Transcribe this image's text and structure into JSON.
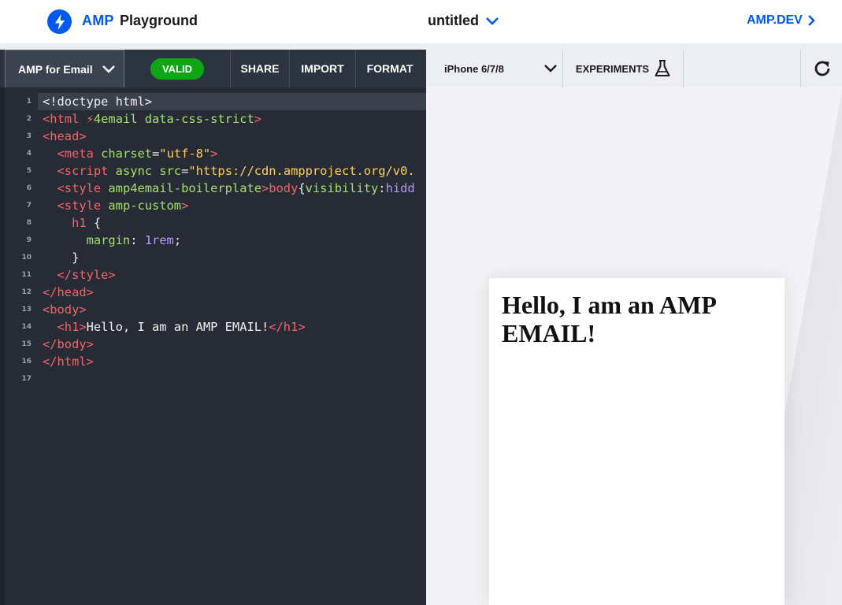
{
  "header": {
    "brand_amp": "AMP",
    "brand_playground": "Playground",
    "document_title": "untitled",
    "ampdev_link": "AMP.DEV"
  },
  "editor_toolbar": {
    "format_select": "AMP for Email",
    "valid_badge": "VALID",
    "share": "SHARE",
    "import": "IMPORT",
    "format": "FORMAT"
  },
  "preview_toolbar": {
    "device_select": "iPhone 6/7/8",
    "experiments": "EXPERIMENTS"
  },
  "editor": {
    "line_numbers": [
      "1",
      "2",
      "3",
      "4",
      "5",
      "6",
      "7",
      "8",
      "9",
      "10",
      "11",
      "12",
      "13",
      "14",
      "15",
      "16",
      "17"
    ],
    "lines": [
      [
        {
          "t": "txt",
          "v": "<!doctype html>"
        }
      ],
      [
        {
          "t": "tag",
          "v": "<html "
        },
        {
          "t": "bolt",
          "v": "⚡"
        },
        {
          "t": "attr",
          "v": "4email data-css-strict"
        },
        {
          "t": "tag",
          "v": ">"
        }
      ],
      [
        {
          "t": "tag",
          "v": "<head>"
        }
      ],
      [
        {
          "t": "tag",
          "v": "  <meta "
        },
        {
          "t": "attr",
          "v": "charset"
        },
        {
          "t": "txt",
          "v": "="
        },
        {
          "t": "str",
          "v": "\"utf-8\""
        },
        {
          "t": "tag",
          "v": ">"
        }
      ],
      [
        {
          "t": "tag",
          "v": "  <script "
        },
        {
          "t": "attr",
          "v": "async src"
        },
        {
          "t": "txt",
          "v": "="
        },
        {
          "t": "str",
          "v": "\"https://cdn.ampproject.org/v0."
        }
      ],
      [
        {
          "t": "tag",
          "v": "  <style "
        },
        {
          "t": "attr",
          "v": "amp4email-boilerplate"
        },
        {
          "t": "tag",
          "v": ">body"
        },
        {
          "t": "txt",
          "v": "{"
        },
        {
          "t": "attr",
          "v": "visibility"
        },
        {
          "t": "txt",
          "v": ":"
        },
        {
          "t": "num",
          "v": "hidd"
        }
      ],
      [
        {
          "t": "tag",
          "v": "  <style "
        },
        {
          "t": "attr",
          "v": "amp-custom"
        },
        {
          "t": "tag",
          "v": ">"
        }
      ],
      [
        {
          "t": "tag",
          "v": "    h1 "
        },
        {
          "t": "txt",
          "v": "{"
        }
      ],
      [
        {
          "t": "attr",
          "v": "      margin"
        },
        {
          "t": "txt",
          "v": ": "
        },
        {
          "t": "num",
          "v": "1rem"
        },
        {
          "t": "txt",
          "v": ";"
        }
      ],
      [
        {
          "t": "txt",
          "v": "    }"
        }
      ],
      [
        {
          "t": "tag",
          "v": "  </style>"
        }
      ],
      [
        {
          "t": "tag",
          "v": "</head>"
        }
      ],
      [
        {
          "t": "tag",
          "v": "<body>"
        }
      ],
      [
        {
          "t": "tag",
          "v": "  <h1>"
        },
        {
          "t": "txt",
          "v": "Hello, I am an AMP EMAIL!"
        },
        {
          "t": "tag",
          "v": "</h1>"
        }
      ],
      [
        {
          "t": "tag",
          "v": "</body>"
        }
      ],
      [
        {
          "t": "tag",
          "v": "</html>"
        }
      ],
      []
    ],
    "active_line": 1
  },
  "preview": {
    "heading": "Hello, I am an AMP EMAIL!"
  },
  "colors": {
    "brand_blue": "#005af0",
    "valid_green": "#0fa616",
    "editor_bg": "#272b36",
    "toolbar_dark": "#2c3440"
  },
  "icons": [
    "bolt-icon",
    "chevron-down-icon",
    "chevron-right-icon",
    "flask-icon",
    "reload-icon"
  ]
}
